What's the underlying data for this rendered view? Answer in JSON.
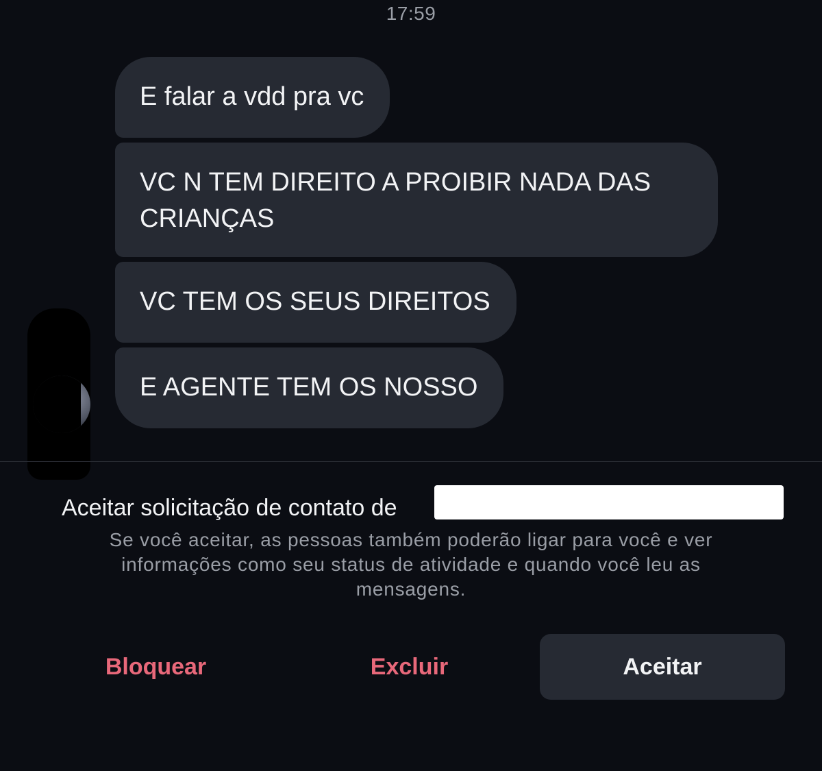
{
  "header": {
    "timestamp": "17:59"
  },
  "messages": [
    {
      "text": "E falar a vdd pra vc"
    },
    {
      "text": "VC N TEM DIREITO A PROIBIR NADA DAS CRIANÇAS"
    },
    {
      "text": "VC TEM OS SEUS DIREITOS"
    },
    {
      "text": "E AGENTE TEM OS NOSSO"
    }
  ],
  "request": {
    "title": "Aceitar solicitação de contato de",
    "description": "Se você aceitar, as pessoas também poderão ligar para você e ver informações como seu status de atividade e quando você leu as mensagens."
  },
  "actions": {
    "block_label": "Bloquear",
    "delete_label": "Excluir",
    "accept_label": "Aceitar"
  },
  "colors": {
    "background": "#0b0d13",
    "bubble": "#262a33",
    "danger": "#e8687a",
    "muted_text": "#9a9ea6"
  }
}
